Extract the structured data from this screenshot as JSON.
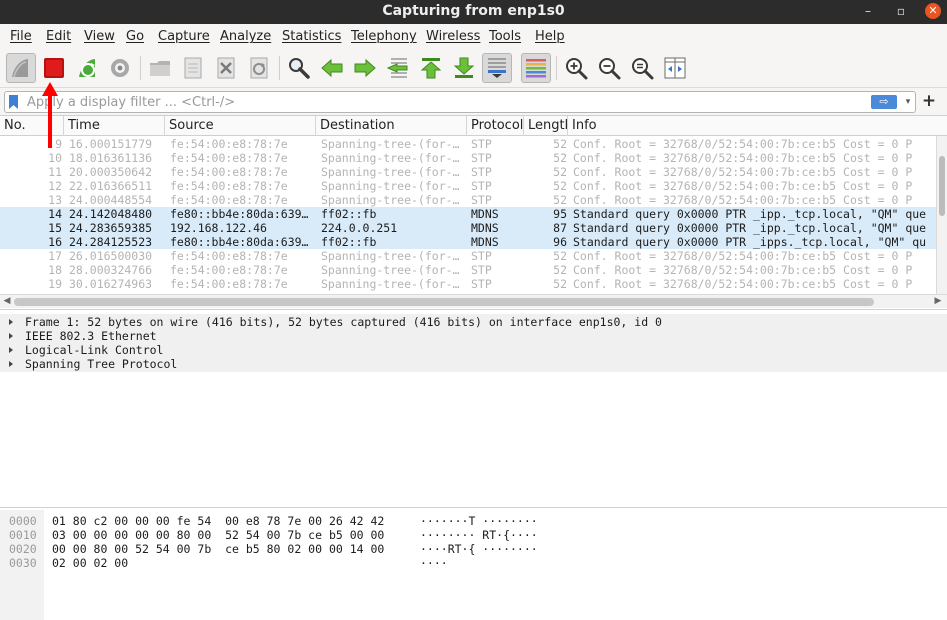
{
  "window": {
    "title": "Capturing from enp1s0",
    "controls": {
      "minimize": "–",
      "maximize": "▫",
      "close": "✕"
    }
  },
  "menu": [
    "File",
    "Edit",
    "View",
    "Go",
    "Capture",
    "Analyze",
    "Statistics",
    "Telephony",
    "Wireless",
    "Tools",
    "Help"
  ],
  "toolbar": {
    "buttons": [
      "start-capture-icon",
      "stop-capture-icon",
      "restart-capture-icon",
      "capture-options-icon",
      "open-file-icon",
      "save-file-icon",
      "close-file-icon",
      "reload-file-icon",
      "find-packet-icon",
      "go-back-icon",
      "go-forward-icon",
      "go-to-packet-icon",
      "go-first-icon",
      "go-last-icon",
      "autoscroll-icon",
      "colorize-icon",
      "zoom-in-icon",
      "zoom-out-icon",
      "zoom-normal-icon",
      "resize-columns-icon"
    ],
    "stop_color": "#e01b1b"
  },
  "filter": {
    "placeholder": "Apply a display filter ... <Ctrl-/>",
    "value": "",
    "apply_arrow": "⇨",
    "dropdown": "▾",
    "add": "+"
  },
  "packet_list": {
    "columns": [
      "No.",
      "Time",
      "Source",
      "Destination",
      "Protocol",
      "Length",
      "Info"
    ],
    "rows": [
      {
        "no": "9",
        "time": "16.000151779",
        "src": "fe:54:00:e8:78:7e",
        "dst": "Spanning-tree-(for-…",
        "proto": "STP",
        "len": "52",
        "info": "Conf. Root = 32768/0/52:54:00:7b:ce:b5  Cost = 0  P",
        "kind": "stp"
      },
      {
        "no": "10",
        "time": "18.016361136",
        "src": "fe:54:00:e8:78:7e",
        "dst": "Spanning-tree-(for-…",
        "proto": "STP",
        "len": "52",
        "info": "Conf. Root = 32768/0/52:54:00:7b:ce:b5  Cost = 0  P",
        "kind": "stp"
      },
      {
        "no": "11",
        "time": "20.000350642",
        "src": "fe:54:00:e8:78:7e",
        "dst": "Spanning-tree-(for-…",
        "proto": "STP",
        "len": "52",
        "info": "Conf. Root = 32768/0/52:54:00:7b:ce:b5  Cost = 0  P",
        "kind": "stp"
      },
      {
        "no": "12",
        "time": "22.016366511",
        "src": "fe:54:00:e8:78:7e",
        "dst": "Spanning-tree-(for-…",
        "proto": "STP",
        "len": "52",
        "info": "Conf. Root = 32768/0/52:54:00:7b:ce:b5  Cost = 0  P",
        "kind": "stp"
      },
      {
        "no": "13",
        "time": "24.000448554",
        "src": "fe:54:00:e8:78:7e",
        "dst": "Spanning-tree-(for-…",
        "proto": "STP",
        "len": "52",
        "info": "Conf. Root = 32768/0/52:54:00:7b:ce:b5  Cost = 0  P",
        "kind": "stp"
      },
      {
        "no": "14",
        "time": "24.142048480",
        "src": "fe80::bb4e:80da:639…",
        "dst": "ff02::fb",
        "proto": "MDNS",
        "len": "95",
        "info": "Standard query 0x0000 PTR _ipp._tcp.local, \"QM\" que",
        "kind": "mdns"
      },
      {
        "no": "15",
        "time": "24.283659385",
        "src": "192.168.122.46",
        "dst": "224.0.0.251",
        "proto": "MDNS",
        "len": "87",
        "info": "Standard query 0x0000 PTR _ipp._tcp.local, \"QM\" que",
        "kind": "mdns"
      },
      {
        "no": "16",
        "time": "24.284125523",
        "src": "fe80::bb4e:80da:639…",
        "dst": "ff02::fb",
        "proto": "MDNS",
        "len": "96",
        "info": "Standard query 0x0000 PTR _ipps._tcp.local, \"QM\" qu",
        "kind": "mdns"
      },
      {
        "no": "17",
        "time": "26.016500030",
        "src": "fe:54:00:e8:78:7e",
        "dst": "Spanning-tree-(for-…",
        "proto": "STP",
        "len": "52",
        "info": "Conf. Root = 32768/0/52:54:00:7b:ce:b5  Cost = 0  P",
        "kind": "stp"
      },
      {
        "no": "18",
        "time": "28.000324766",
        "src": "fe:54:00:e8:78:7e",
        "dst": "Spanning-tree-(for-…",
        "proto": "STP",
        "len": "52",
        "info": "Conf. Root = 32768/0/52:54:00:7b:ce:b5  Cost = 0  P",
        "kind": "stp"
      },
      {
        "no": "19",
        "time": "30.016274963",
        "src": "fe:54:00:e8:78:7e",
        "dst": "Spanning-tree-(for-…",
        "proto": "STP",
        "len": "52",
        "info": "Conf. Root = 32768/0/52:54:00:7b:ce:b5  Cost = 0  P",
        "kind": "stp"
      }
    ]
  },
  "details": [
    "Frame 1: 52 bytes on wire (416 bits), 52 bytes captured (416 bits) on interface enp1s0, id 0",
    "IEEE 802.3 Ethernet",
    "Logical-Link Control",
    "Spanning Tree Protocol"
  ],
  "bytes": [
    {
      "offset": "0000",
      "hex": "01 80 c2 00 00 00 fe 54  00 e8 78 7e 00 26 42 42",
      "ascii": "·······T ········"
    },
    {
      "offset": "0010",
      "hex": "03 00 00 00 00 00 80 00  52 54 00 7b ce b5 00 00",
      "ascii": "········ RT·{····"
    },
    {
      "offset": "0020",
      "hex": "00 00 80 00 52 54 00 7b  ce b5 80 02 00 00 14 00",
      "ascii": "····RT·{ ········"
    },
    {
      "offset": "0030",
      "hex": "02 00 02 00",
      "ascii": "····"
    }
  ],
  "annotation": {
    "arrow_color": "#ff0000"
  }
}
